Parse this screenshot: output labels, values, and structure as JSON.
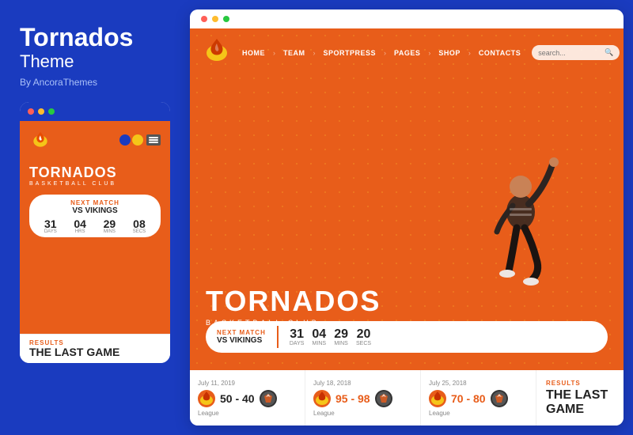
{
  "left": {
    "brand": {
      "title": "Tornados",
      "subtitle": "Theme",
      "by": "By AncoraThemes"
    },
    "mobile": {
      "hero_title": "TORNADOS",
      "hero_sub": "BASKETBALL CLUB",
      "match_label": "NEXT MATCH",
      "match_vs": "VS VIKINGS",
      "countdown": [
        {
          "num": "31",
          "label": "Days"
        },
        {
          "num": "04",
          "label": "Hrs"
        },
        {
          "num": "29",
          "label": "Mins"
        },
        {
          "num": "08",
          "label": "Secs"
        }
      ],
      "results_label": "RESULTS",
      "last_game": "THE LAST GAME"
    }
  },
  "right": {
    "nav": {
      "links": [
        "HOME",
        "TEAM",
        "SPORTPRESS",
        "PAGES",
        "SHOP",
        "CONTACTS"
      ],
      "search_placeholder": "search..."
    },
    "hero": {
      "title": "TORNADOS",
      "subtitle": "BASKETBALL CLUB"
    },
    "next_match": {
      "label": "NEXT MATCH",
      "vs": "VS VIKINGS",
      "countdown": [
        {
          "num": "31",
          "label": "Days"
        },
        {
          "num": "04",
          "label": "Mins"
        },
        {
          "num": "29",
          "label": "Mins"
        },
        {
          "num": "20",
          "label": "Secs"
        }
      ]
    },
    "results": [
      {
        "date": "July 11, 2019",
        "score": "50 - 40",
        "score_win": true,
        "type": "League"
      },
      {
        "date": "July 18, 2018",
        "score": "95 - 98",
        "score_win": false,
        "type": "League"
      },
      {
        "date": "July 25, 2018",
        "score": "70 - 80",
        "score_win": false,
        "type": "League"
      }
    ],
    "last_game_label": "RESULTS",
    "last_game_title": "THE LAST GAME"
  }
}
